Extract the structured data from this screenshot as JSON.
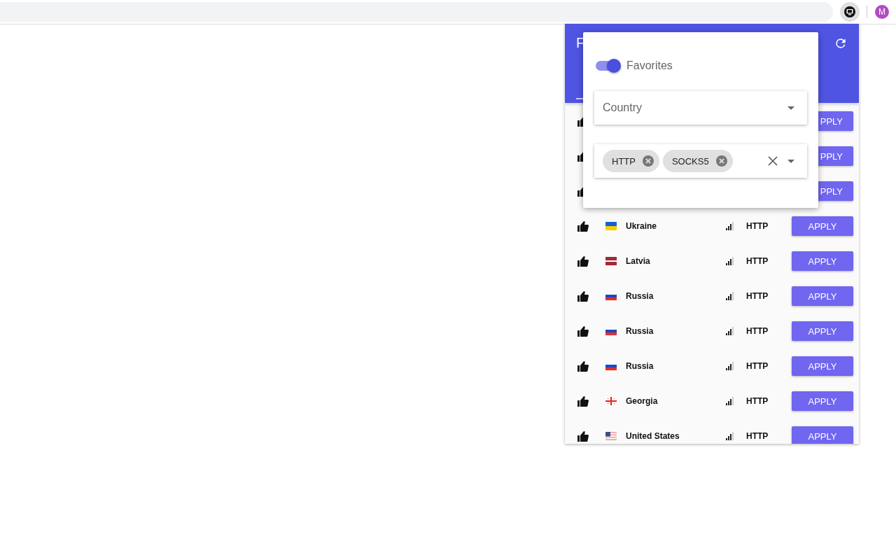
{
  "browser": {
    "avatar": "M"
  },
  "panel": {
    "title": "F",
    "rows": [
      {
        "kind": "covered",
        "button": "PPLY"
      },
      {
        "kind": "covered",
        "button": "PPLY"
      },
      {
        "kind": "covered",
        "button": "PPLY"
      },
      {
        "kind": "full",
        "flag": {
          "kind": "ua"
        },
        "country": "Ukraine",
        "protocol": "HTTP",
        "button": "APPLY"
      },
      {
        "kind": "full",
        "flag": {
          "kind": "lv"
        },
        "country": "Latvia",
        "protocol": "HTTP",
        "button": "APPLY"
      },
      {
        "kind": "full",
        "flag": {
          "kind": "ru"
        },
        "country": "Russia",
        "protocol": "HTTP",
        "button": "APPLY"
      },
      {
        "kind": "full",
        "flag": {
          "kind": "ru"
        },
        "country": "Russia",
        "protocol": "HTTP",
        "button": "APPLY"
      },
      {
        "kind": "full",
        "flag": {
          "kind": "ru"
        },
        "country": "Russia",
        "protocol": "HTTP",
        "button": "APPLY"
      },
      {
        "kind": "full",
        "flag": {
          "kind": "ge"
        },
        "country": "Georgia",
        "protocol": "HTTP",
        "button": "APPLY"
      },
      {
        "kind": "full",
        "flag": {
          "kind": "us"
        },
        "country": "United States",
        "protocol": "HTTP",
        "button": "APPLY"
      }
    ]
  },
  "filter": {
    "favorites": {
      "label": "Favorites",
      "on": true
    },
    "country": {
      "placeholder": "Country"
    },
    "protocol": {
      "chips": [
        "HTTP",
        "SOCKS5"
      ]
    }
  }
}
